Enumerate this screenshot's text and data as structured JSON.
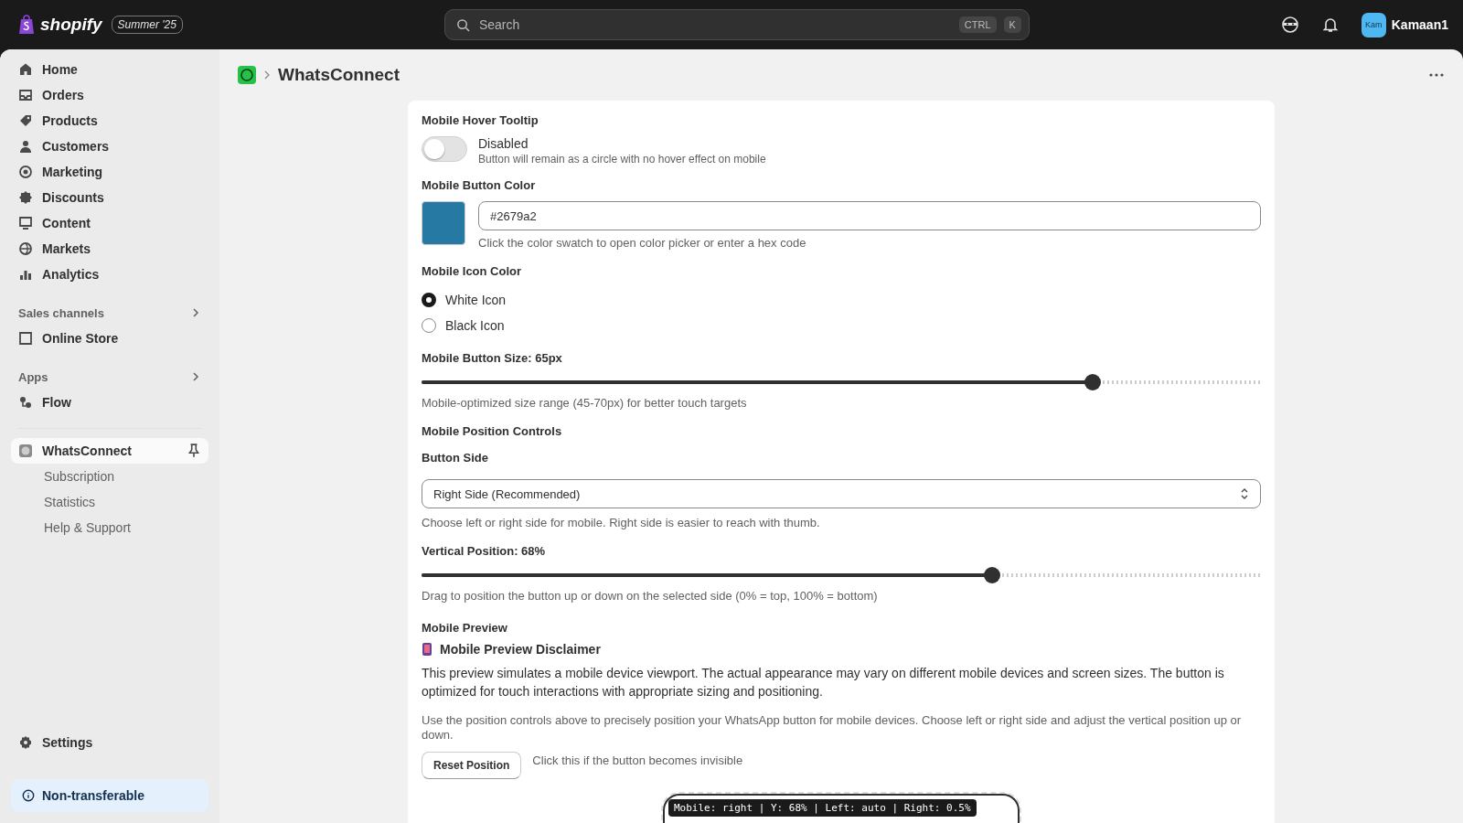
{
  "topbar": {
    "brand": "shopify",
    "edition": "Summer '25",
    "search": {
      "placeholder": "Search"
    },
    "shortcut": [
      "CTRL",
      "K"
    ],
    "avatar": "Kam",
    "user": "Kamaan1"
  },
  "sidebar": {
    "items": [
      {
        "label": "Home",
        "selected": false
      },
      {
        "label": "Orders",
        "selected": false
      },
      {
        "label": "Products",
        "selected": false
      },
      {
        "label": "Customers",
        "selected": false
      },
      {
        "label": "Marketing",
        "selected": false
      },
      {
        "label": "Discounts",
        "selected": false
      },
      {
        "label": "Content",
        "selected": false
      },
      {
        "label": "Markets",
        "selected": false
      },
      {
        "label": "Analytics",
        "selected": false
      }
    ],
    "sections": [
      {
        "title": "Sales channels",
        "items": [
          {
            "label": "Online Store",
            "selected": false
          }
        ]
      },
      {
        "title": "Apps",
        "items": [
          {
            "label": "Flow",
            "selected": false
          }
        ]
      }
    ],
    "app": {
      "label": "WhatsConnect",
      "selected": true,
      "children": [
        {
          "label": "Subscription",
          "selected": false
        },
        {
          "label": "Statistics",
          "selected": false
        },
        {
          "label": "Help & Support",
          "selected": false
        }
      ]
    },
    "settings": "Settings",
    "notice": "Non-transferable"
  },
  "page": {
    "title": "WhatsConnect"
  },
  "form": {
    "tooltip": {
      "label": "Mobile Hover Tooltip",
      "on": false,
      "state": "Disabled",
      "hint": "Button will remain as a circle with no hover effect on mobile"
    },
    "color": {
      "label": "Mobile Button Color",
      "color": "#2679a2",
      "value": "#2679a2",
      "hint": "Click the color swatch to open color picker or enter a hex code"
    },
    "icon_color": {
      "label": "Mobile Icon Color",
      "options": [
        {
          "label": "White Icon",
          "selected": true
        },
        {
          "label": "Black Icon",
          "selected": false
        }
      ]
    },
    "size": {
      "label": "Mobile Button Size: 65px",
      "level": 0.8,
      "hint": "Mobile-optimized size range (45-70px) for better touch targets"
    },
    "position_heading": "Mobile Position Controls",
    "side": {
      "label": "Button Side",
      "value": "Right Side (Recommended)",
      "hint": "Choose left or right side for mobile. Right side is easier to reach with thumb."
    },
    "vertical": {
      "label": "Vertical Position: 68%",
      "level": 0.68,
      "hint": "Drag to position the button up or down on the selected side (0% = top, 100% = bottom)"
    },
    "preview": {
      "label": "Mobile Preview",
      "disclaimer_title": "Mobile Preview Disclaimer",
      "disclaimer": "This preview simulates a mobile device viewport. The actual appearance may vary on different mobile devices and screen sizes. The button is optimized for touch interactions with appropriate sizing and positioning.",
      "note": "Use the position controls above to precisely position your WhatsApp button for mobile devices. Choose left or right side and adjust the vertical position up or down.",
      "reset": "Reset Position",
      "reset_hint": "Click this if the button becomes invisible",
      "status": "Mobile: right | Y: 68% | Left: auto | Right: 0.5%"
    }
  }
}
